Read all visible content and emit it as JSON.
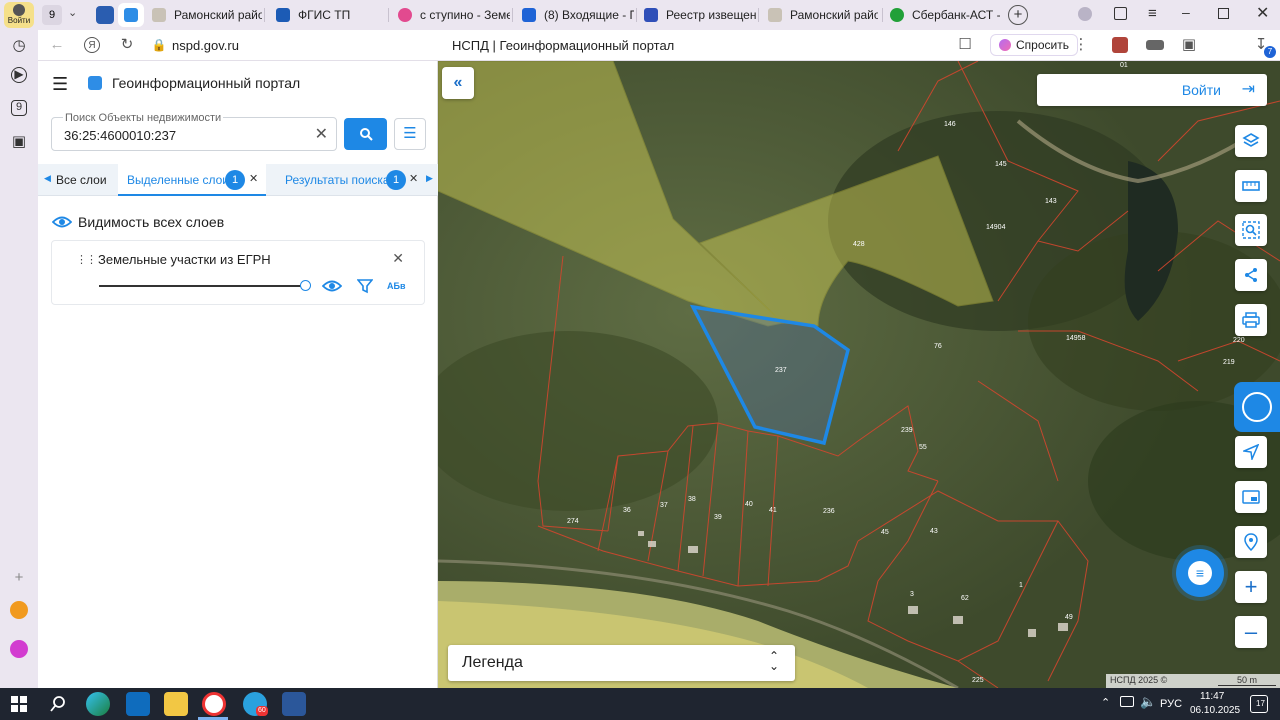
{
  "browser": {
    "profile_label": "Войти",
    "tab_count": "9",
    "tabs": [
      {
        "label": "Рамонский район",
        "fav_color": "#c9c2b6"
      },
      {
        "label": "ФГИС ТП",
        "fav_color": "#1c5bb5"
      },
      {
        "label": "с ступино - Земел",
        "fav_color": "#e24a8f"
      },
      {
        "label": "(8) Входящие - По",
        "fav_color": "#1e63d6"
      },
      {
        "label": "Реестр извещени",
        "fav_color": "#2f4fb8"
      },
      {
        "label": "Рамонский район",
        "fav_color": "#c9c2b6"
      },
      {
        "label": "Сбербанк-АСТ - Э",
        "fav_color": "#21a038"
      }
    ],
    "url": "nspd.gov.ru",
    "page_title": "НСПД | Геоинформационный портал",
    "ask_label": "Спросить",
    "downloads_badge": "7",
    "rail_badge": "9"
  },
  "panel": {
    "app_title": "Геоинформационный портал",
    "search": {
      "label": "Поиск Объекты недвижимости",
      "value": "36:25:4600010:237"
    },
    "tabs": [
      {
        "label": "Все слои"
      },
      {
        "label": "Выделенные слои",
        "count": "1"
      },
      {
        "label": "Результаты поиска",
        "count": "1"
      }
    ],
    "visibility_label": "Видимость всех слоев",
    "layer": {
      "name": "Земельные участки из ЕГРН",
      "opacity": 1.0,
      "label_btn": "АБв"
    }
  },
  "map": {
    "login_label": "Войти",
    "legend_label": "Легенда",
    "copyright": "НСПД 2025 ©",
    "scale": "50 m",
    "highlight_color": "#1e88e5",
    "parcel_labels": [
      "237",
      "428",
      "146",
      "145",
      "143",
      "14904",
      "14958",
      "76",
      "219",
      "220",
      "239",
      "55",
      "45",
      "43",
      "274",
      "36",
      "37",
      "38",
      "39",
      "40",
      "41",
      "236",
      "3",
      "62",
      "1",
      "49",
      "01",
      "225"
    ]
  },
  "taskbar": {
    "tray_lang": "РУС",
    "time": "11:47",
    "date": "06.10.2025",
    "notif_count": "17",
    "telegram_badge": "60"
  }
}
